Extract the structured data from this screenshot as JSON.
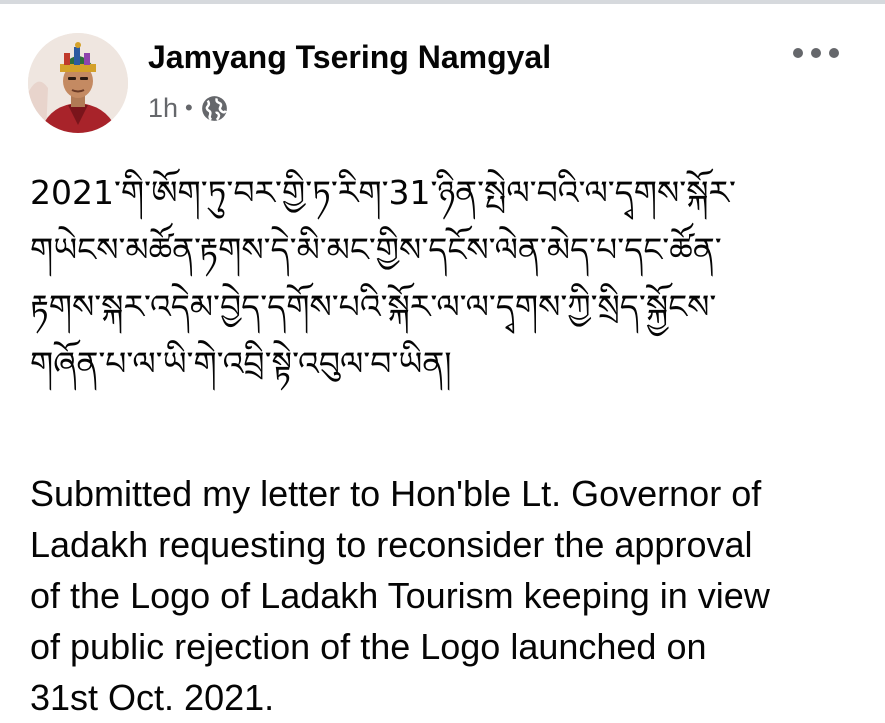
{
  "post": {
    "author": "Jamyang Tsering Namgyal",
    "time": "1h",
    "separator": "•",
    "audience_icon": "globe-icon",
    "more_icon": "more-options-icon",
    "tibetan_lines": [
      "2021་གི་ཨོག་ཏུ་བར་གྱི་ཏ་རིག་31་ཉིན་སྤེལ་བའི་ལ་དྭགས་སྐོར་",
      "གཡེངས་མཚོན་རྟགས་དེ་མི་མང་གྱིས་དངོས་ལེན་མེད་པ་དང་ཚོན་",
      "རྟགས་སྐར་འདེམ་བྱེད་དགོས་པའི་སྐོར་ལ་ལ་དྭགས་ཀྱི་སྲིད་སྐྱོངས་",
      "གཞོན་པ་ལ་ཡི་གེ་འབྲི་སྟེ་འབུལ་བ་ཡིན།"
    ],
    "english_lines": [
      "Submitted my letter to Hon'ble Lt. Governor of",
      "Ladakh requesting to reconsider the approval",
      "of the Logo of Ladakh Tourism keeping in view",
      "of public rejection of the Logo launched on",
      "31st Oct. 2021."
    ]
  },
  "colors": {
    "text": "#050505",
    "secondary": "#65676b",
    "divider": "#d6d9dd"
  }
}
